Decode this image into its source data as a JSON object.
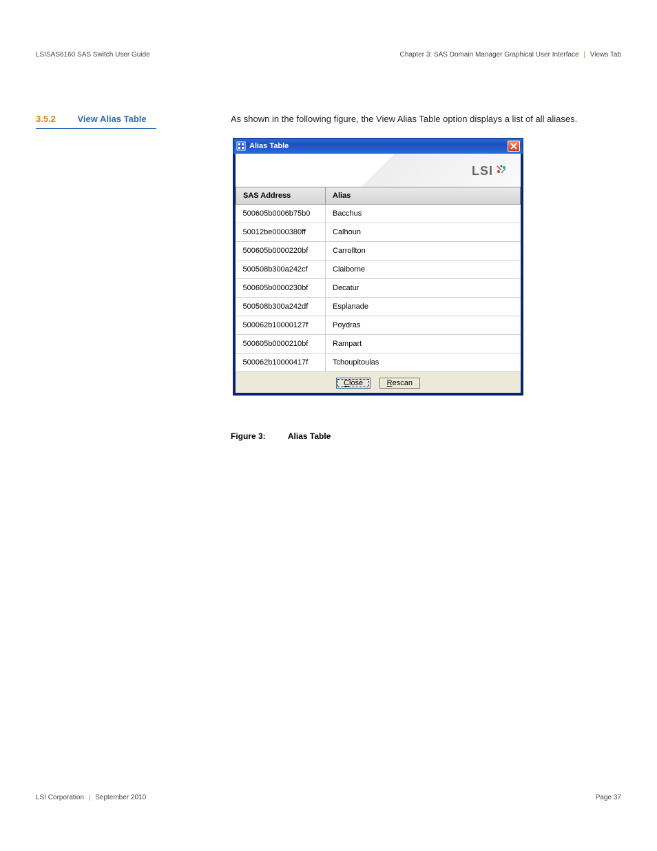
{
  "header": {
    "left": "LSISAS6160 SAS Switch User Guide",
    "right_chapter": "Chapter 3: SAS Domain Manager Graphical User Interface",
    "right_tab": "Views Tab"
  },
  "section": {
    "number": "3.5.2",
    "title": "View Alias Table",
    "body": "As shown in the following figure, the View Alias Table option displays a list of all aliases."
  },
  "window": {
    "title": "Alias Table",
    "brand": "LSI",
    "columns": {
      "c0": "SAS Address",
      "c1": "Alias"
    },
    "rows": [
      {
        "addr": "500605b0006b75b0",
        "alias": "Bacchus"
      },
      {
        "addr": "50012be0000380ff",
        "alias": "Calhoun"
      },
      {
        "addr": "500605b0000220bf",
        "alias": "Carrollton"
      },
      {
        "addr": "500508b300a242cf",
        "alias": "Claiborne"
      },
      {
        "addr": "500605b0000230bf",
        "alias": "Decatur"
      },
      {
        "addr": "500508b300a242df",
        "alias": "Esplanade"
      },
      {
        "addr": "500062b10000127f",
        "alias": "Poydras"
      },
      {
        "addr": "500605b0000210bf",
        "alias": "Rampart"
      },
      {
        "addr": "500062b10000417f",
        "alias": "Tchoupitoulas"
      }
    ],
    "buttons": {
      "close": "Close",
      "rescan": "Rescan"
    }
  },
  "figure": {
    "label": "Figure 3:",
    "title": "Alias Table"
  },
  "footer": {
    "company": "LSI Corporation",
    "date": "September 2010",
    "page": "Page 37"
  }
}
